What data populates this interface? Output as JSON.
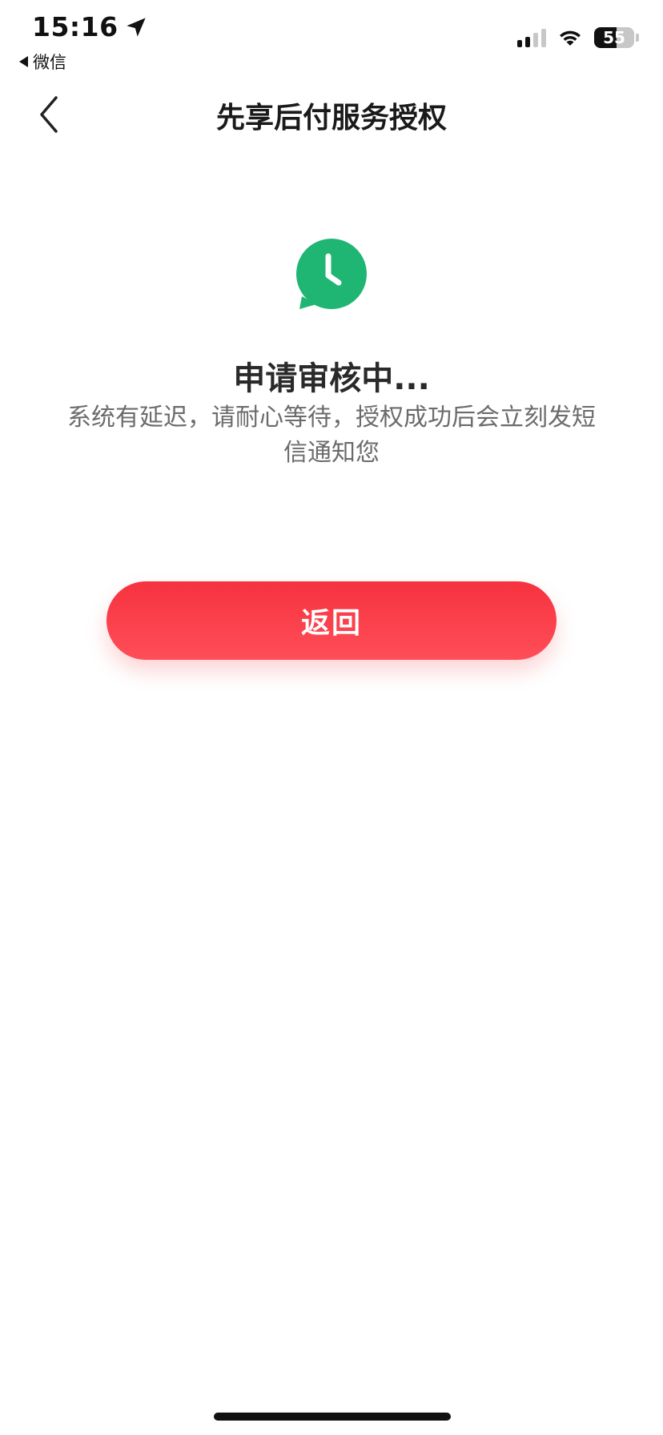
{
  "status_bar": {
    "time": "15:16",
    "back_app": "微信",
    "battery": "55",
    "battery_level": 0.55
  },
  "nav": {
    "title": "先享后付服务授权"
  },
  "review": {
    "icon": "clock-chat-icon",
    "title": "申请审核中...",
    "description": "系统有延迟，请耐心等待，授权成功后会立刻发短信通知您"
  },
  "actions": {
    "return_label": "返回"
  },
  "colors": {
    "accent_red": "#f6323f",
    "success_green": "#1fb573"
  }
}
